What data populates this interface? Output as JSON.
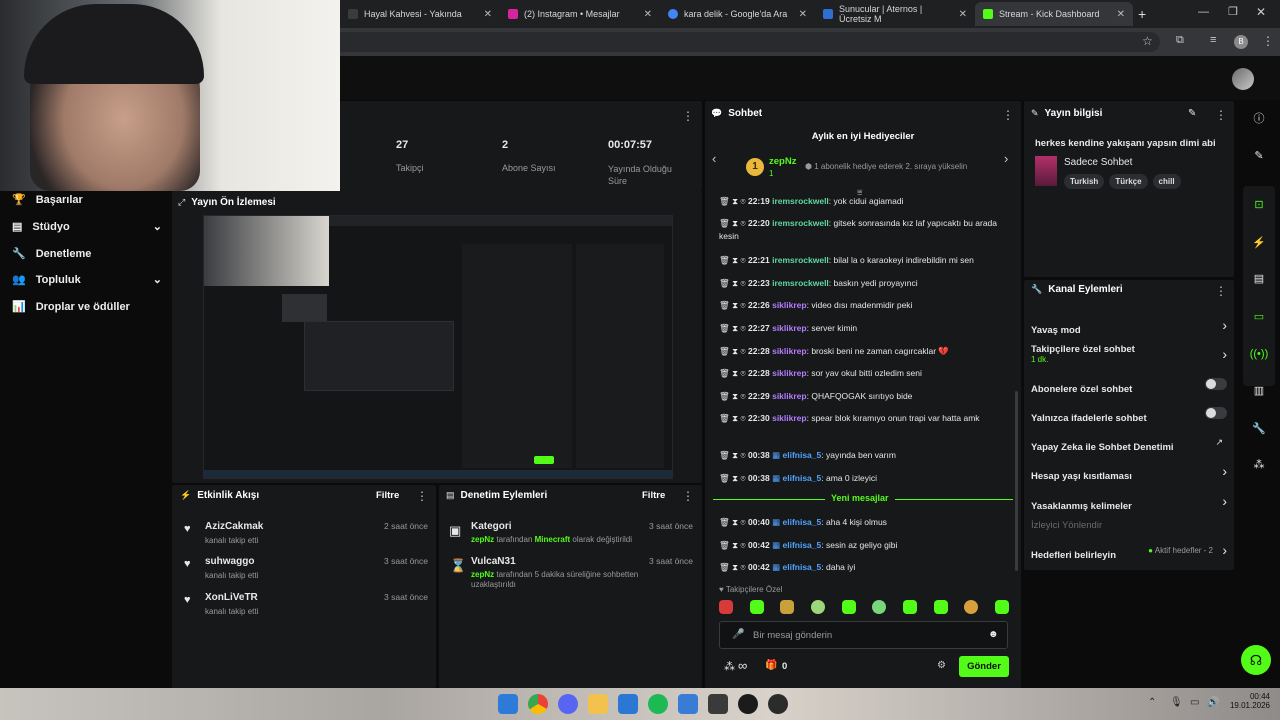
{
  "browser": {
    "tabs": [
      {
        "label": "Hayal Kahvesi - Yakında",
        "color": "#3b3b3b"
      },
      {
        "label": "(2) Instagram • Mesajlar",
        "color": "#d6249f"
      },
      {
        "label": "kara delik - Google'da Ara",
        "color": "#4285f4"
      },
      {
        "label": "Sunucular | Aternos | Ücretsiz M",
        "color": "#2f6fd1"
      },
      {
        "label": "Stream - Kick Dashboard",
        "color": "#53fc18"
      }
    ],
    "new_tab": "+",
    "profile_initial": "B"
  },
  "stats": {
    "items": [
      {
        "value": "27",
        "label": "Takipçi"
      },
      {
        "value": "2",
        "label": "Abone Sayısı"
      },
      {
        "value": "00:07:57",
        "label": "Yayında Olduğu Süre"
      }
    ]
  },
  "sidebar": {
    "items": [
      {
        "label": "Başarılar",
        "icon": "trophy-icon"
      },
      {
        "label": "Stüdyo",
        "icon": "studio-icon",
        "chevron": true
      },
      {
        "label": "Denetleme",
        "icon": "wrench-icon"
      },
      {
        "label": "Topluluk",
        "icon": "people-icon",
        "chevron": true
      },
      {
        "label": "Droplar ve ödüller",
        "icon": "gift-icon"
      }
    ]
  },
  "preview": {
    "title": "Yayın Ön İzlemesi"
  },
  "activity": {
    "title": "Etkinlik Akışı",
    "filter": "Filtre",
    "items": [
      {
        "name": "AzizCakmak",
        "text": "kanalı takip etti",
        "time": "2 saat önce"
      },
      {
        "name": "suhwaggo",
        "text": "kanalı takip etti",
        "time": "3 saat önce"
      },
      {
        "name": "XonLiVeTR",
        "text": "kanalı takip etti",
        "time": "3 saat önce"
      }
    ]
  },
  "moderation": {
    "title": "Denetim Eylemleri",
    "filter": "Filtre",
    "items": [
      {
        "title": "Kategori",
        "actor": "zepNz",
        "mid": "tarafından",
        "highlight": "Minecraft",
        "rest": "olarak değiştirildi",
        "time": "3 saat önce"
      },
      {
        "title": "VulcaN31",
        "actor": "zepNz",
        "mid": "tarafından 5 dakika süreliğine sohbetten uzaklaştırıldı",
        "highlight": "",
        "rest": "",
        "time": "3 saat önce"
      }
    ]
  },
  "chat": {
    "title": "Sohbet",
    "gifters_title": "Aylık en iyi Hediyeciler",
    "top_gifter": "zepNz",
    "top_gifter_count": "1",
    "gifter_rank": "1",
    "gift_hint": "1 abonelik hediye ederek 2. sıraya yükselin",
    "messages": [
      {
        "time": "22:19",
        "user": "iremsrockwell",
        "color": "#5ed9a0",
        "text": "yok cidui agiamadi",
        "kick": false
      },
      {
        "time": "22:20",
        "user": "iremsrockwell",
        "color": "#5ed9a0",
        "text": "gitsek sonrasında kız laf yapıcaktı bu arada kesin",
        "kick": false
      },
      {
        "time": "22:21",
        "user": "iremsrockwell",
        "color": "#5ed9a0",
        "text": "bilal la o karaokeyi indirebildin mi sen",
        "kick": false
      },
      {
        "time": "22:23",
        "user": "iremsrockwell",
        "color": "#5ed9a0",
        "text": "baskın yedi proyayınci",
        "kick": false
      },
      {
        "time": "22:26",
        "user": "siklikrep",
        "color": "#b57cff",
        "text": "video dısı madenmidir peki",
        "kick": false
      },
      {
        "time": "22:27",
        "user": "siklikrep",
        "color": "#b57cff",
        "text": "server kimin",
        "kick": false
      },
      {
        "time": "22:28",
        "user": "siklikrep",
        "color": "#b57cff",
        "text": "broski beni ne zaman cagırcaklar 💔",
        "kick": false
      },
      {
        "time": "22:28",
        "user": "siklikrep",
        "color": "#b57cff",
        "text": "sor yav okul bitti ozledim seni",
        "kick": false
      },
      {
        "time": "22:29",
        "user": "siklikrep",
        "color": "#b57cff",
        "text": "QHAFQOGAK sırıtıyo bide",
        "kick": false
      },
      {
        "time": "22:30",
        "user": "siklikrep",
        "color": "#b57cff",
        "text": "spear blok kıramıyo onun trapi var hatta amk",
        "kick": false
      },
      {
        "time": "00:38",
        "user": "elifnisa_5",
        "color": "#4fa3ff",
        "text": "yayında ben varım",
        "kick": true
      },
      {
        "time": "00:38",
        "user": "elifnisa_5",
        "color": "#4fa3ff",
        "text": "ama 0 izleyici",
        "kick": true
      }
    ],
    "new_messages_label": "Yeni mesajlar",
    "new_messages": [
      {
        "time": "00:40",
        "user": "elifnisa_5",
        "color": "#4fa3ff",
        "text": "aha 4 kişi olmus",
        "kick": true
      },
      {
        "time": "00:42",
        "user": "elifnisa_5",
        "color": "#4fa3ff",
        "text": "sesin az geliyo gibi",
        "kick": true
      },
      {
        "time": "00:42",
        "user": "elifnisa_5",
        "color": "#4fa3ff",
        "text": "daha iyi",
        "kick": true
      }
    ],
    "followers_only": "Takipçilere Özel",
    "input_placeholder": "Bir mesaj gönderin",
    "infinity": "∞",
    "gift_count": "0",
    "send": "Gönder"
  },
  "stream_info": {
    "title": "Yayın bilgisi",
    "stream_title": "herkes kendine yakışanı yapsın dimi abi",
    "category": "Sadece Sohbet",
    "tags": [
      "Turkish",
      "Türkçe",
      "chill"
    ]
  },
  "channel_actions": {
    "title": "Kanal Eylemleri",
    "slow_mode": "Yavaş mod",
    "followers_only": "Takipçilere özel sohbet",
    "followers_only_sub": "1 dk.",
    "subs_only": "Abonelere özel sohbet",
    "emotes_only": "Yalnızca ifadelerle sohbet",
    "ai_mod": "Yapay Zeka ile Sohbet Denetimi",
    "account_age": "Hesap yaşı kısıtlaması",
    "banned_words": "Yasaklanmış kelimeler",
    "viewer_directed": "İzleyici Yönlendir",
    "goals": "Hedefleri belirleyin",
    "goals_status": "Aktif hedefler - 2"
  },
  "taskbar": {
    "time": "00:44",
    "date": "19.01.2026"
  }
}
